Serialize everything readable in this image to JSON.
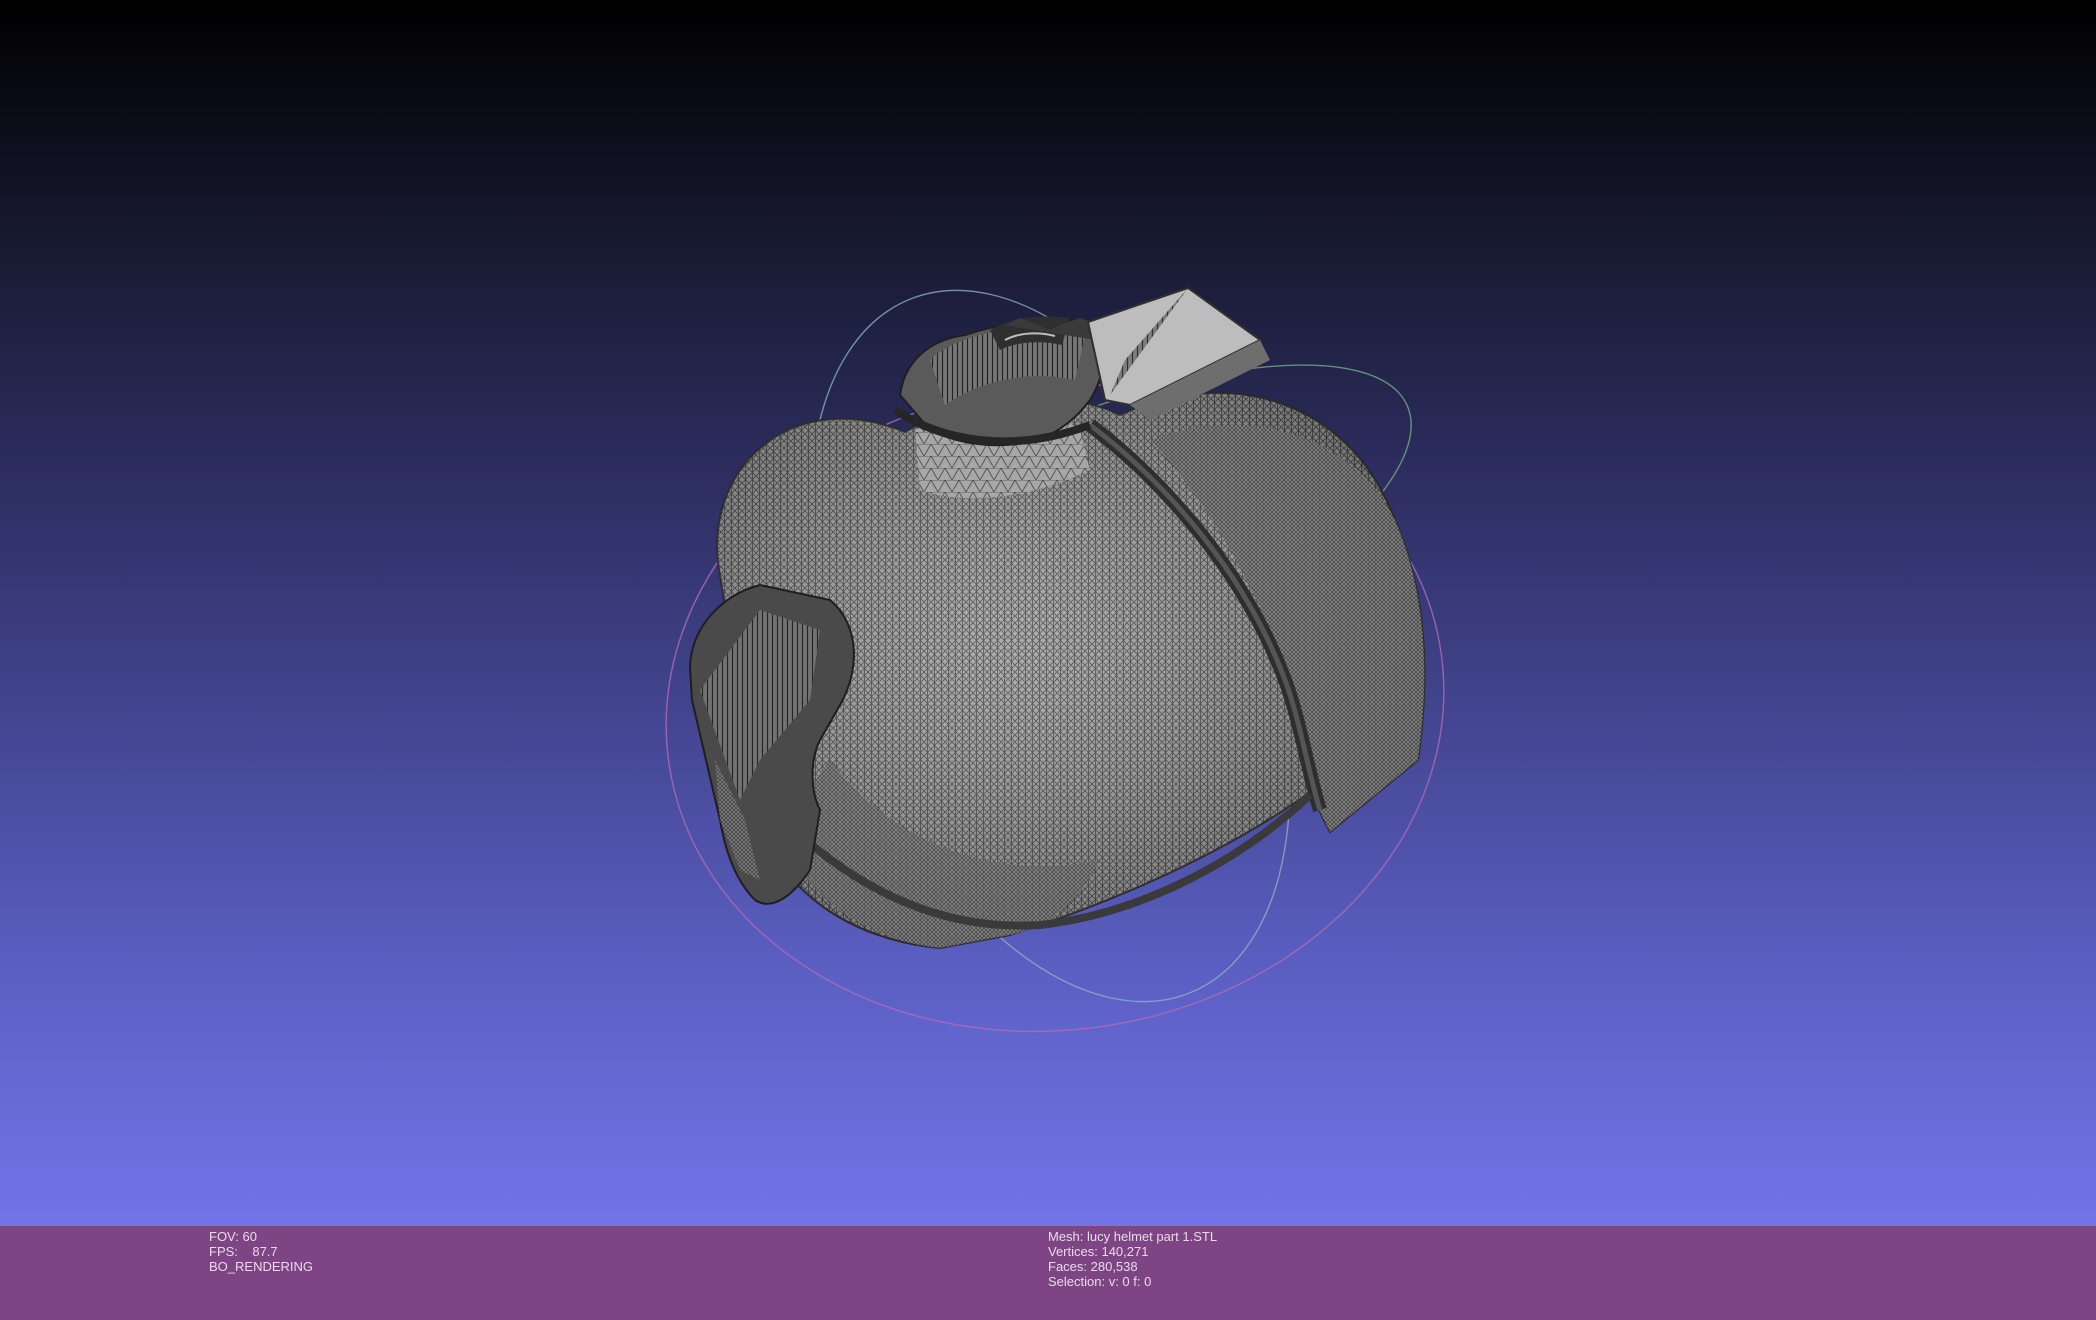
{
  "render_info": {
    "fov": "FOV: 60",
    "fps": "FPS:    87.7",
    "mode": "BO_RENDERING"
  },
  "mesh_info": {
    "mesh": "Mesh: lucy helmet part 1.STL",
    "vertices": "Vertices: 140,271",
    "faces": "Faces: 280,538",
    "selection": "Selection: v: 0 f: 0"
  }
}
